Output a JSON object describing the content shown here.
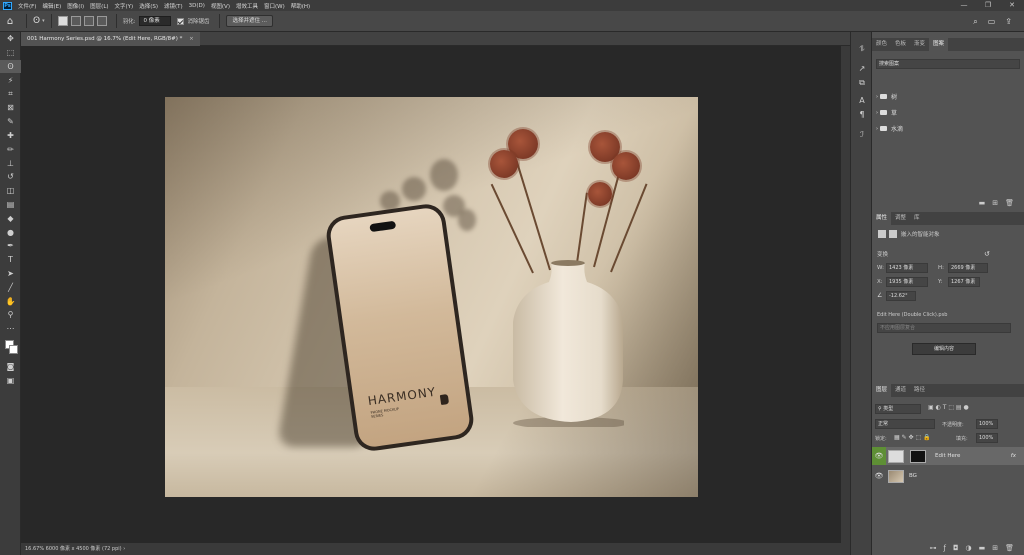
{
  "menubar": {
    "items": [
      "文件(F)",
      "编辑(E)",
      "图像(I)",
      "图层(L)",
      "文字(Y)",
      "选择(S)",
      "滤镜(T)",
      "3D(D)",
      "视图(V)",
      "增效工具",
      "窗口(W)",
      "帮助(H)"
    ],
    "window_controls": [
      "—",
      "❐",
      "✕"
    ]
  },
  "options": {
    "feather_label": "羽化:",
    "feather_value": "0 像素",
    "antialias_label": "消除锯齿",
    "select_mask_button": "选择并遮住 ..."
  },
  "document": {
    "tab_title": "001 Harmony Series.psd @ 16.7% (Edit Here, RGB/8#) *",
    "tab_close": "×",
    "status": "16.67%   6000 像素 x 4500 像素 (72 ppi)   ›"
  },
  "photo": {
    "brand": "HARMONY",
    "sub_line1": "PHONE MOCKUP",
    "sub_line2": "SERIES"
  },
  "swatches_panel": {
    "tabs": [
      "颜色",
      "色板",
      "渐变",
      "图案"
    ],
    "search_placeholder": "搜索图案",
    "folders": [
      "树",
      "草",
      "水滴"
    ]
  },
  "properties_panel": {
    "tabs": [
      "属性",
      "调整",
      "库"
    ],
    "type_label": "嵌入的智能对象",
    "transform_label": "变换",
    "w_label": "W:",
    "w_value": "1423 像素",
    "h_label": "H:",
    "h_value": "2669 像素",
    "x_label": "X:",
    "x_value": "1935 像素",
    "y_label": "Y:",
    "y_value": "1267 像素",
    "angle_value": "-12.62°",
    "file_name": "Edit Here (Double Click).psb",
    "comp_placeholder": "不应用图层复合",
    "edit_contents_button": "编辑内容"
  },
  "layers_panel": {
    "tabs": [
      "图层",
      "通道",
      "路径"
    ],
    "kind_label": "类型",
    "blend_mode": "正常",
    "opacity_label": "不透明度:",
    "opacity_value": "100%",
    "lock_label": "锁定:",
    "fill_label": "填充:",
    "fill_value": "100%",
    "layers": [
      {
        "name": "Edit Here"
      },
      {
        "name": "BG"
      }
    ],
    "fx_label": "fx"
  }
}
